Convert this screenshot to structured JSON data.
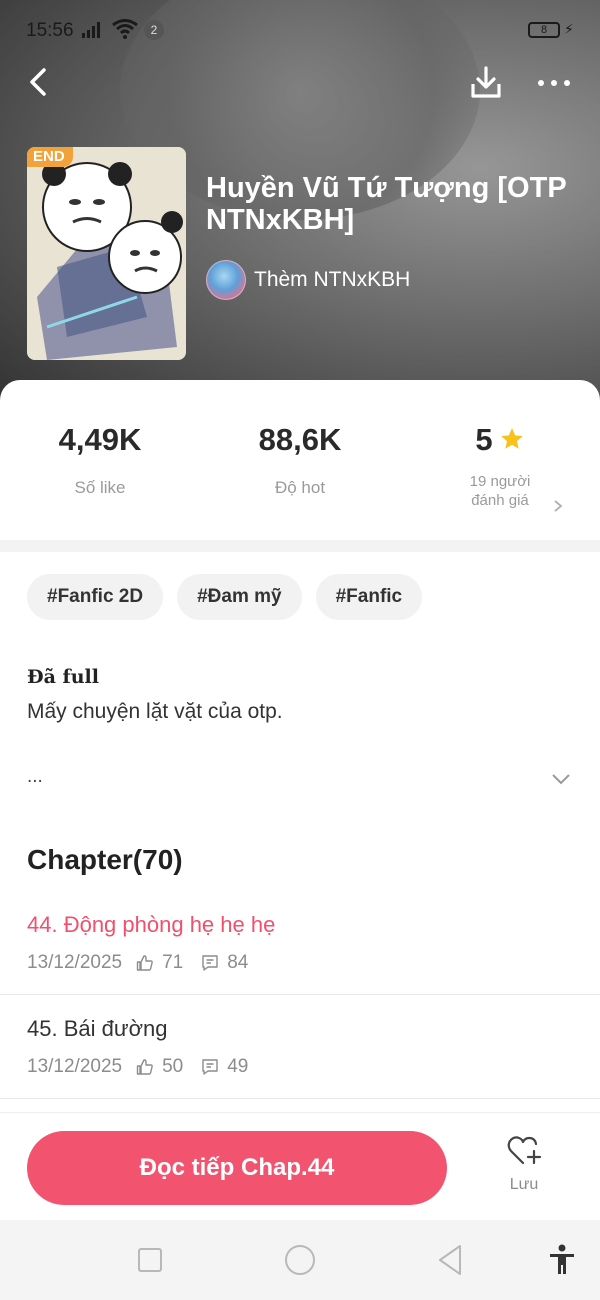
{
  "status_bar": {
    "time": "15:56",
    "notification_count": "2",
    "battery": "8"
  },
  "header": {
    "back_icon": "chevron-left-icon",
    "download_icon": "download-icon",
    "more_icon": "more-dots-icon"
  },
  "story": {
    "badge": "END",
    "title": "Huyền Vũ Tứ Tượng [OTP NTNxKBH]",
    "author": "Thèm NTNxKBH"
  },
  "stats": {
    "likes_value": "4,49K",
    "likes_label": "Số like",
    "hot_value": "88,6K",
    "hot_label": "Độ hot",
    "rating_value": "5",
    "rating_label_line1": "19 người",
    "rating_label_line2": "đánh giá"
  },
  "tags": [
    "#Fanfic 2D",
    "#Đam mỹ",
    "#Fanfic"
  ],
  "description": {
    "status": "Đã full",
    "text": "Mấy chuyện lặt vặt của otp.",
    "more": "..."
  },
  "chapters": {
    "heading": "Chapter(70)",
    "items": [
      {
        "title": "44. Động phòng hẹ hẹ hẹ",
        "date": "13/12/2025",
        "likes": "71",
        "comments": "84",
        "current": true
      },
      {
        "title": "45. Bái đường",
        "date": "13/12/2025",
        "likes": "50",
        "comments": "49",
        "current": false
      }
    ]
  },
  "actions": {
    "continue_label": "Đọc tiếp Chap.44",
    "save_label": "Lưu"
  },
  "colors": {
    "accent": "#f25470",
    "current_chapter": "#f0506e",
    "badge": "#f2a23a",
    "star": "#f7c21e"
  }
}
